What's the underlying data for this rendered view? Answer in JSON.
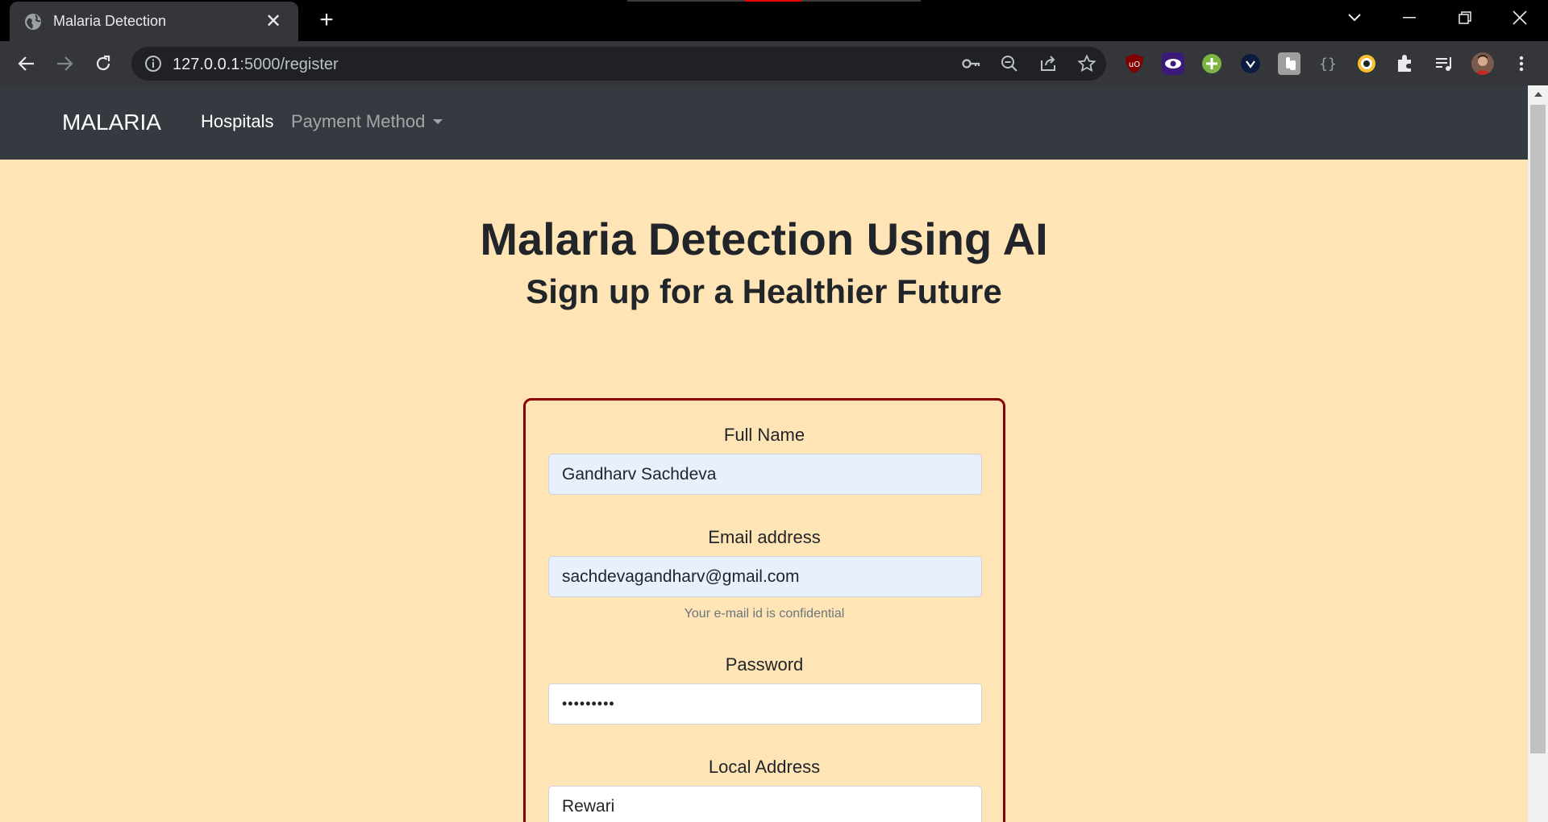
{
  "browser": {
    "tab_title": "Malaria Detection",
    "url_host": "127.0.0.1",
    "url_rest": ":5000/register"
  },
  "navbar": {
    "brand": "MALARIA",
    "links": [
      {
        "label": "Hospitals"
      },
      {
        "label": "Payment Method"
      }
    ]
  },
  "header": {
    "title": "Malaria Detection Using AI",
    "subtitle": "Sign up for a Healthier Future"
  },
  "form": {
    "full_name": {
      "label": "Full Name",
      "value": "Gandharv Sachdeva"
    },
    "email": {
      "label": "Email address",
      "value": "sachdevagandharv@gmail.com",
      "hint": "Your e-mail id is confidential"
    },
    "password": {
      "label": "Password",
      "value": "•••••••••"
    },
    "address": {
      "label": "Local Address",
      "value": "Rewari"
    }
  },
  "colors": {
    "page_bg": "#ffe4b5",
    "navbar_bg": "#343a40",
    "card_border": "#8b0000",
    "autofill_bg": "#e8f0fe"
  }
}
